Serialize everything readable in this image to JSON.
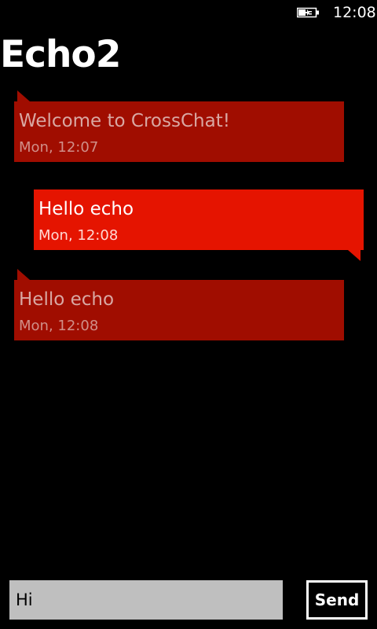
{
  "status_bar": {
    "time": "12:08",
    "battery_icon": "battery-charging-icon"
  },
  "page": {
    "title": "Echo2"
  },
  "colors": {
    "incoming_bubble": "#a00d00",
    "incoming_text": "#d9a8a3",
    "incoming_time": "#d08f89",
    "outgoing_bubble": "#e51400",
    "outgoing_text": "#ffffff",
    "outgoing_time": "#ffd9d4"
  },
  "messages": [
    {
      "direction": "incoming",
      "text": "Welcome to CrossChat!",
      "time": "Mon, 12:07"
    },
    {
      "direction": "outgoing",
      "text": "Hello echo",
      "time": "Mon, 12:08"
    },
    {
      "direction": "incoming",
      "text": "Hello echo",
      "time": "Mon, 12:08"
    }
  ],
  "composer": {
    "value": "Hi",
    "placeholder": ""
  },
  "send_button": {
    "label": "Send"
  }
}
